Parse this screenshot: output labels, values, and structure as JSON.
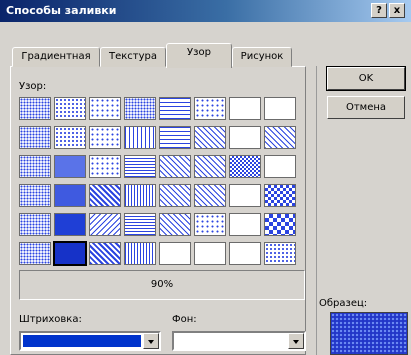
{
  "window": {
    "title": "Способы заливки"
  },
  "titlebar_buttons": {
    "help": "?",
    "close": "x"
  },
  "tabs": [
    {
      "label": "Градиентная",
      "active": false
    },
    {
      "label": "Текстура",
      "active": false
    },
    {
      "label": "Узор",
      "active": true
    },
    {
      "label": "Рисунок",
      "active": false
    }
  ],
  "pattern_section": {
    "label": "Узор:"
  },
  "selected_pattern": {
    "label": "90%"
  },
  "buttons": {
    "ok": "OK",
    "cancel": "Отмена"
  },
  "foreground": {
    "label": "Штриховка:",
    "color": "#0033cc"
  },
  "background": {
    "label": "Фон:",
    "color": "#ffffff"
  },
  "sample": {
    "label": "Образец:"
  },
  "colors": {
    "pattern_fg": "#2b44e0",
    "pattern_bg": "#ffffff",
    "title_bar": "#0a246a",
    "dialog": "#d6d3ce"
  },
  "patterns": [
    "dots-5",
    "dots-10",
    "dots-20",
    "dots-25",
    "horz-light",
    "dots-sparse",
    "grid-dashed",
    "grid-small",
    "dots-sparse-2",
    "dots-30",
    "dots-40",
    "vert-lines",
    "horz-lines",
    "diag-fine",
    "wave",
    "diag-dash",
    "dots-med",
    "solid-60",
    "dots-50",
    "horz-dense",
    "diag-fine-2",
    "diag-fine-3",
    "checker-sm",
    "lines-thin",
    "dots-light",
    "solid-70",
    "diag-dark",
    "vert-dense",
    "diag-light",
    "diag-wide",
    "diamond",
    "checker-med",
    "dots-light-2",
    "solid-80",
    "diag-back",
    "horz-narrow",
    "diag-cross",
    "dots-big",
    "lattice",
    "checker-lg",
    "dots-faint",
    "solid-90",
    "diag-strong",
    "vert-narrow",
    "zigzag",
    "grid-large",
    "plaid",
    "dots-large"
  ]
}
